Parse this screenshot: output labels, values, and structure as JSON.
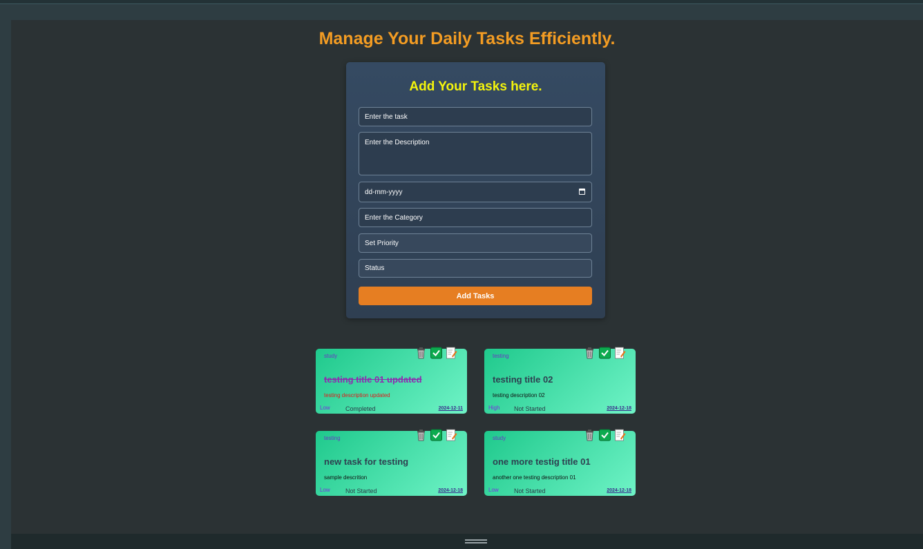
{
  "page": {
    "title": "Manage Your Daily Tasks Efficiently."
  },
  "form": {
    "title": "Add Your Tasks here.",
    "task_placeholder": "Enter the task",
    "description_placeholder": "Enter the Description",
    "date_placeholder": "dd-mm-yyyy",
    "category_placeholder": "Enter the Category",
    "priority_placeholder": "Set Priority",
    "status_placeholder": "Status",
    "submit_label": "Add Tasks"
  },
  "tasks": [
    {
      "category": "study",
      "title": "testing title 01 updated",
      "description": "testing description updated",
      "priority": "Low",
      "status": "Completed",
      "date": "2024-12-11",
      "completed": true
    },
    {
      "category": "testing",
      "title": "testing title 02",
      "description": "testing description 02",
      "priority": "High",
      "status": "Not Started",
      "date": "2024-12-18",
      "completed": false
    },
    {
      "category": "testing",
      "title": "new task for testing",
      "description": "sample descrition",
      "priority": "Low",
      "status": "Not Started",
      "date": "2024-12-18",
      "completed": false
    },
    {
      "category": "study",
      "title": "one more testig title 01",
      "description": "another one testing description 01",
      "priority": "Low",
      "status": "Not Started",
      "date": "2024-12-18",
      "completed": false
    }
  ],
  "icons": {
    "delete": "trash-icon",
    "complete": "check-icon",
    "edit": "edit-icon"
  },
  "colors": {
    "title_accent": "#f39c23",
    "form_title": "#f4f40c",
    "button": "#e67e22",
    "card_gradient_start": "#1fc98c",
    "card_gradient_end": "#6ff3c6"
  }
}
